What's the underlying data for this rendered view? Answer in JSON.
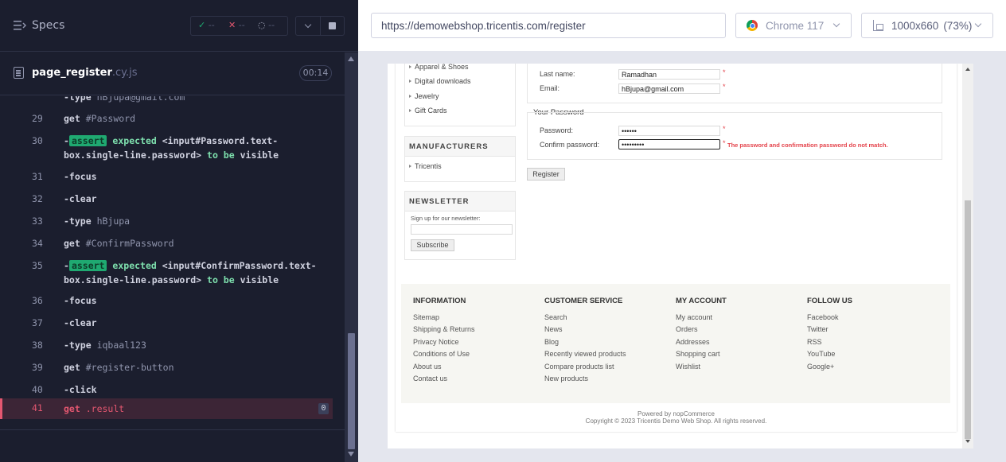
{
  "header": {
    "specs_label": "Specs",
    "stats": {
      "passed": "--",
      "failed": "--",
      "pending": "--"
    }
  },
  "spec_file": {
    "name": "page_register",
    "ext": ".cy.js",
    "duration": "00:14"
  },
  "commands": [
    {
      "num": "",
      "parts": [
        {
          "t": "-type",
          "c": ""
        },
        {
          "t": "hBjupa@gmail.com",
          "c": "arg"
        }
      ]
    },
    {
      "num": "29",
      "parts": [
        {
          "t": "get",
          "c": ""
        },
        {
          "t": "#Password",
          "c": "arg"
        }
      ]
    },
    {
      "num": "30",
      "parts": [
        {
          "t": "-",
          "c": ""
        },
        {
          "t": "assert",
          "c": "tag"
        },
        {
          "t": "expected",
          "c": "green"
        },
        {
          "t": "<input#Password.text-",
          "c": ""
        }
      ],
      "line2": [
        {
          "t": "box.single-line.password>",
          "c": ""
        },
        {
          "t": "to be",
          "c": "green"
        },
        {
          "t": "visible",
          "c": ""
        }
      ]
    },
    {
      "num": "31",
      "parts": [
        {
          "t": "-focus",
          "c": ""
        }
      ]
    },
    {
      "num": "32",
      "parts": [
        {
          "t": "-clear",
          "c": ""
        }
      ]
    },
    {
      "num": "33",
      "parts": [
        {
          "t": "-type",
          "c": ""
        },
        {
          "t": "hBjupa",
          "c": "arg"
        }
      ]
    },
    {
      "num": "34",
      "parts": [
        {
          "t": "get",
          "c": ""
        },
        {
          "t": "#ConfirmPassword",
          "c": "arg"
        }
      ]
    },
    {
      "num": "35",
      "parts": [
        {
          "t": "-",
          "c": ""
        },
        {
          "t": "assert",
          "c": "tag"
        },
        {
          "t": "expected",
          "c": "green"
        },
        {
          "t": "<input#ConfirmPassword.text-",
          "c": ""
        }
      ],
      "line2": [
        {
          "t": "box.single-line.password>",
          "c": ""
        },
        {
          "t": "to be",
          "c": "green"
        },
        {
          "t": "visible",
          "c": ""
        }
      ]
    },
    {
      "num": "36",
      "parts": [
        {
          "t": "-focus",
          "c": ""
        }
      ]
    },
    {
      "num": "37",
      "parts": [
        {
          "t": "-clear",
          "c": ""
        }
      ]
    },
    {
      "num": "38",
      "parts": [
        {
          "t": "-type",
          "c": ""
        },
        {
          "t": "iqbaal123",
          "c": "arg"
        }
      ]
    },
    {
      "num": "39",
      "parts": [
        {
          "t": "get",
          "c": ""
        },
        {
          "t": "#register-button",
          "c": "arg"
        }
      ]
    },
    {
      "num": "40",
      "parts": [
        {
          "t": "-click",
          "c": ""
        }
      ]
    },
    {
      "num": "41",
      "parts": [
        {
          "t": "get",
          "c": ""
        },
        {
          "t": ".result",
          "c": "arg"
        }
      ],
      "active": true,
      "badge": "0"
    }
  ],
  "browser": {
    "url": "https://demowebshop.tricentis.com/register",
    "name": "Chrome 117",
    "viewport": "1000x660",
    "scale": "(73%)"
  },
  "aut": {
    "categories": [
      "Apparel & Shoes",
      "Digital downloads",
      "Jewelry",
      "Gift Cards"
    ],
    "manufacturers_title": "MANUFACTURERS",
    "manufacturers": [
      "Tricentis"
    ],
    "newsletter_title": "NEWSLETTER",
    "newsletter_label": "Sign up for our newsletter:",
    "newsletter_value": "",
    "subscribe_label": "Subscribe",
    "last_name_label": "Last name:",
    "last_name_value": "Ramadhan",
    "email_label": "Email:",
    "email_value": "hBjupa@gmail.com",
    "password_section": "Your Password",
    "password_label": "Password:",
    "password_value": "••••••",
    "confirm_label": "Confirm password:",
    "confirm_value": "•••••••••",
    "error_message": "The password and confirmation password do not match.",
    "required_mark": "*",
    "register_label": "Register",
    "footer": [
      {
        "title": "INFORMATION",
        "links": [
          "Sitemap",
          "Shipping & Returns",
          "Privacy Notice",
          "Conditions of Use",
          "About us",
          "Contact us"
        ]
      },
      {
        "title": "CUSTOMER SERVICE",
        "links": [
          "Search",
          "News",
          "Blog",
          "Recently viewed products",
          "Compare products list",
          "New products"
        ]
      },
      {
        "title": "MY ACCOUNT",
        "links": [
          "My account",
          "Orders",
          "Addresses",
          "Shopping cart",
          "Wishlist"
        ]
      },
      {
        "title": "FOLLOW US",
        "links": [
          "Facebook",
          "Twitter",
          "RSS",
          "YouTube",
          "Google+"
        ]
      }
    ],
    "powered_by": "Powered by nopCommerce",
    "copyright": "Copyright © 2023 Tricentis Demo Web Shop. All rights reserved."
  },
  "colors": {
    "pass": "#1fa971",
    "fail": "#e45770",
    "panel_bg": "#1b1e2e"
  }
}
